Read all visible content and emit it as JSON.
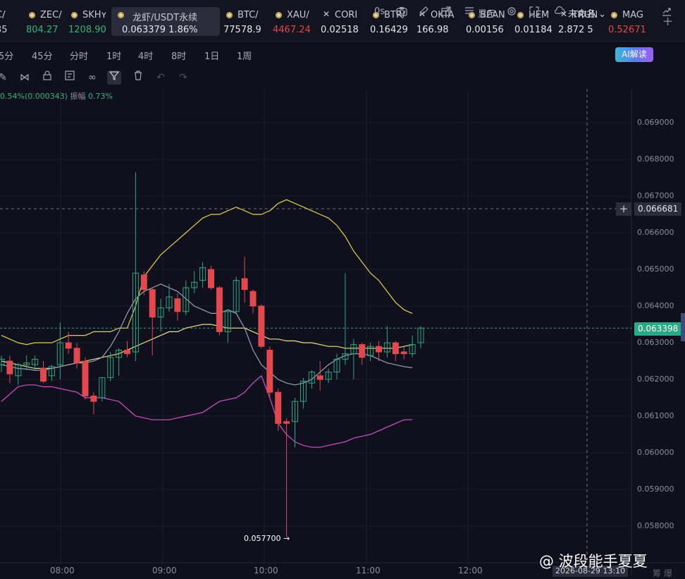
{
  "tickers": [
    {
      "name": "C/",
      "price": "35",
      "price_color": "#c7cad3",
      "marker": "none"
    },
    {
      "name": "ZEC/",
      "price": "804.27",
      "price_color": "#2fb37b",
      "marker": "dot"
    },
    {
      "name": "SKHʏ",
      "price": "1208.90",
      "price_color": "#2fb37b",
      "marker": "dot"
    },
    {
      "name": "龙虾/USDT永续",
      "price": "0.063379",
      "change": "1.86%",
      "price_color": "#e3e5ec",
      "marker": "dot",
      "selected": true
    },
    {
      "name": "BTC/",
      "price": "77578.9",
      "price_color": "#e3e5ec",
      "marker": "dot"
    },
    {
      "name": "XAU/",
      "price": "4467.24",
      "price_color": "#e1494f",
      "marker": "dot"
    },
    {
      "name": "CORI",
      "price": "0.02518",
      "price_color": "#e3e5ec",
      "marker": "x"
    },
    {
      "name": "BTR/",
      "price": "0.16429",
      "price_color": "#e3e5ec",
      "marker": "dot"
    },
    {
      "name": "OKTA",
      "price": "166.98",
      "price_color": "#e3e5ec",
      "marker": "x"
    },
    {
      "name": "BEAN",
      "price": "0.00156",
      "price_color": "#e3e5ec",
      "marker": "dot"
    },
    {
      "name": "HEM",
      "price": "0.01184",
      "price_color": "#e3e5ec",
      "marker": "dot"
    },
    {
      "name": "TRUN",
      "price": "2.872",
      "extra": "5",
      "price_color": "#e3e5ec",
      "marker": "x"
    },
    {
      "name": "MAG",
      "price": "0.52671",
      "price_color": "#e1494f",
      "marker": "dot"
    }
  ],
  "plus_label": "+",
  "timeframes": [
    "5分",
    "45分",
    "分时",
    "1时",
    "4时",
    "8时",
    "1日",
    "1周"
  ],
  "toolbar": {
    "countdown": "0s",
    "display_label": "显示",
    "unnamed_label": "未命名",
    "ai_label": "AI解读"
  },
  "indicator_info": {
    "change": "0.54%(0.000343)",
    "amplitude_label": "振幅",
    "amplitude": "0.73%"
  },
  "price_axis": [
    "0.069000",
    "0.068000",
    "0.067000",
    "0.066000",
    "0.065000",
    "0.064000",
    "0.063000",
    "0.062000",
    "0.061000",
    "0.060000",
    "0.059000",
    "0.058000"
  ],
  "time_axis": [
    "08:00",
    "09:00",
    "10:00",
    "11:00",
    "12:00"
  ],
  "crosshair_price": "0.066681",
  "last_price": "0.063398",
  "low_label": "0.057700 →",
  "crosshair_time": "2026-08-29 13:10",
  "watermark": "@ 波段能手夏夏",
  "watermark_sub": "筹 爆",
  "colors": {
    "up": "#2ca884",
    "down": "#e1494f",
    "bg": "#0f101b"
  },
  "chart_data": {
    "type": "candlestick",
    "title": "龙虾/USDT永续",
    "ylim": [
      0.0575,
      0.0697
    ],
    "candles": [
      {
        "t": "07:30",
        "o": 0.0624,
        "h": 0.06265,
        "l": 0.0622,
        "c": 0.06255
      },
      {
        "t": "07:35",
        "o": 0.0625,
        "h": 0.06265,
        "l": 0.0619,
        "c": 0.06215
      },
      {
        "t": "07:40",
        "o": 0.0621,
        "h": 0.06245,
        "l": 0.06185,
        "c": 0.0624
      },
      {
        "t": "07:45",
        "o": 0.0624,
        "h": 0.06265,
        "l": 0.06225,
        "c": 0.06245
      },
      {
        "t": "07:50",
        "o": 0.0624,
        "h": 0.06265,
        "l": 0.06225,
        "c": 0.06255
      },
      {
        "t": "07:55",
        "o": 0.0623,
        "h": 0.0625,
        "l": 0.0619,
        "c": 0.06195
      },
      {
        "t": "08:00",
        "o": 0.0621,
        "h": 0.0624,
        "l": 0.06195,
        "c": 0.06235
      },
      {
        "t": "08:05",
        "o": 0.0624,
        "h": 0.06355,
        "l": 0.062,
        "c": 0.063
      },
      {
        "t": "08:10",
        "o": 0.063,
        "h": 0.0633,
        "l": 0.0627,
        "c": 0.06285
      },
      {
        "t": "08:15",
        "o": 0.06285,
        "h": 0.063,
        "l": 0.0623,
        "c": 0.06245
      },
      {
        "t": "08:20",
        "o": 0.0625,
        "h": 0.0626,
        "l": 0.06145,
        "c": 0.06155
      },
      {
        "t": "08:25",
        "o": 0.06155,
        "h": 0.06165,
        "l": 0.06105,
        "c": 0.0614
      },
      {
        "t": "08:30",
        "o": 0.0615,
        "h": 0.06205,
        "l": 0.0614,
        "c": 0.06205
      },
      {
        "t": "08:35",
        "o": 0.06205,
        "h": 0.06275,
        "l": 0.06195,
        "c": 0.0626
      },
      {
        "t": "08:40",
        "o": 0.0626,
        "h": 0.06285,
        "l": 0.0621,
        "c": 0.0628
      },
      {
        "t": "08:45",
        "o": 0.0628,
        "h": 0.06305,
        "l": 0.0626,
        "c": 0.0627
      },
      {
        "t": "08:50",
        "o": 0.06275,
        "h": 0.06765,
        "l": 0.0625,
        "c": 0.0649
      },
      {
        "t": "08:55",
        "o": 0.06485,
        "h": 0.06495,
        "l": 0.0643,
        "c": 0.06445
      },
      {
        "t": "09:00",
        "o": 0.06445,
        "h": 0.0645,
        "l": 0.06265,
        "c": 0.0637
      },
      {
        "t": "09:05",
        "o": 0.0637,
        "h": 0.0642,
        "l": 0.0633,
        "c": 0.06395
      },
      {
        "t": "09:10",
        "o": 0.06395,
        "h": 0.0646,
        "l": 0.06385,
        "c": 0.06425
      },
      {
        "t": "09:15",
        "o": 0.0642,
        "h": 0.06435,
        "l": 0.0636,
        "c": 0.06385
      },
      {
        "t": "09:20",
        "o": 0.06385,
        "h": 0.0647,
        "l": 0.06375,
        "c": 0.0645
      },
      {
        "t": "09:25",
        "o": 0.0645,
        "h": 0.06495,
        "l": 0.06435,
        "c": 0.06465
      },
      {
        "t": "09:30",
        "o": 0.0647,
        "h": 0.0652,
        "l": 0.0645,
        "c": 0.06505
      },
      {
        "t": "09:35",
        "o": 0.065,
        "h": 0.0651,
        "l": 0.06445,
        "c": 0.0645
      },
      {
        "t": "09:40",
        "o": 0.0645,
        "h": 0.06455,
        "l": 0.0632,
        "c": 0.0633
      },
      {
        "t": "09:45",
        "o": 0.0633,
        "h": 0.0639,
        "l": 0.063,
        "c": 0.06385
      },
      {
        "t": "09:50",
        "o": 0.06385,
        "h": 0.0648,
        "l": 0.0638,
        "c": 0.0647
      },
      {
        "t": "09:55",
        "o": 0.06475,
        "h": 0.06535,
        "l": 0.0641,
        "c": 0.06445
      },
      {
        "t": "10:00",
        "o": 0.0644,
        "h": 0.06445,
        "l": 0.0638,
        "c": 0.064
      },
      {
        "t": "10:05",
        "o": 0.064,
        "h": 0.06405,
        "l": 0.06285,
        "c": 0.0629
      },
      {
        "t": "10:10",
        "o": 0.0628,
        "h": 0.0629,
        "l": 0.0615,
        "c": 0.06165
      },
      {
        "t": "10:15",
        "o": 0.06165,
        "h": 0.06175,
        "l": 0.0606,
        "c": 0.0608
      },
      {
        "t": "10:20",
        "o": 0.06085,
        "h": 0.06095,
        "l": 0.0577,
        "c": 0.0608
      },
      {
        "t": "10:25",
        "o": 0.06085,
        "h": 0.0615,
        "l": 0.06015,
        "c": 0.0614
      },
      {
        "t": "10:30",
        "o": 0.0614,
        "h": 0.06205,
        "l": 0.0612,
        "c": 0.06195
      },
      {
        "t": "10:35",
        "o": 0.0619,
        "h": 0.06225,
        "l": 0.06175,
        "c": 0.0622
      },
      {
        "t": "10:40",
        "o": 0.0621,
        "h": 0.0625,
        "l": 0.0617,
        "c": 0.062
      },
      {
        "t": "10:45",
        "o": 0.062,
        "h": 0.0623,
        "l": 0.0619,
        "c": 0.0622
      },
      {
        "t": "10:50",
        "o": 0.0622,
        "h": 0.0627,
        "l": 0.062,
        "c": 0.06255
      },
      {
        "t": "10:55",
        "o": 0.06255,
        "h": 0.0649,
        "l": 0.0624,
        "c": 0.0627
      },
      {
        "t": "11:00",
        "o": 0.0627,
        "h": 0.0631,
        "l": 0.062,
        "c": 0.06295
      },
      {
        "t": "11:05",
        "o": 0.06295,
        "h": 0.063,
        "l": 0.0624,
        "c": 0.0626
      },
      {
        "t": "11:10",
        "o": 0.06265,
        "h": 0.063,
        "l": 0.0625,
        "c": 0.0629
      },
      {
        "t": "11:15",
        "o": 0.0629,
        "h": 0.06305,
        "l": 0.0625,
        "c": 0.06275
      },
      {
        "t": "11:20",
        "o": 0.06275,
        "h": 0.06345,
        "l": 0.0626,
        "c": 0.063
      },
      {
        "t": "11:25",
        "o": 0.063,
        "h": 0.06305,
        "l": 0.0625,
        "c": 0.0627
      },
      {
        "t": "11:30",
        "o": 0.06275,
        "h": 0.0629,
        "l": 0.06255,
        "c": 0.0627
      },
      {
        "t": "11:35",
        "o": 0.0627,
        "h": 0.0632,
        "l": 0.0626,
        "c": 0.06295
      },
      {
        "t": "11:40",
        "o": 0.063,
        "h": 0.06345,
        "l": 0.06285,
        "c": 0.0634
      }
    ],
    "series": [
      {
        "type": "line",
        "color": "#e2d14c",
        "values": [
          0.0632,
          0.0631,
          0.063,
          0.06295,
          0.063,
          0.063,
          0.063,
          0.0631,
          0.0632,
          0.0632,
          0.0632,
          0.0633,
          0.0633,
          0.0633,
          0.0634,
          0.0634,
          0.064,
          0.0648,
          0.0651,
          0.0654,
          0.0656,
          0.0658,
          0.066,
          0.0662,
          0.0664,
          0.0665,
          0.0665,
          0.0666,
          0.0667,
          0.0666,
          0.0665,
          0.0665,
          0.0666,
          0.0668,
          0.0669,
          0.0668,
          0.0667,
          0.0666,
          0.0665,
          0.0664,
          0.0662,
          0.0659,
          0.0655,
          0.0652,
          0.0649,
          0.0647,
          0.0644,
          0.0641,
          0.0639,
          0.0638
        ]
      },
      {
        "type": "line",
        "color": "#d34fd1",
        "values": [
          0.0614,
          0.0616,
          0.0618,
          0.06185,
          0.06185,
          0.0618,
          0.0618,
          0.06175,
          0.0617,
          0.06165,
          0.0615,
          0.0615,
          0.0615,
          0.06145,
          0.0614,
          0.0612,
          0.061,
          0.06095,
          0.0609,
          0.0609,
          0.0609,
          0.06095,
          0.061,
          0.06105,
          0.0611,
          0.06125,
          0.0614,
          0.06145,
          0.0615,
          0.06165,
          0.0619,
          0.0621,
          0.0615,
          0.0608,
          0.0605,
          0.0603,
          0.0602,
          0.06015,
          0.06015,
          0.0602,
          0.06025,
          0.0603,
          0.0604,
          0.06045,
          0.0605,
          0.0606,
          0.0607,
          0.0608,
          0.0609,
          0.0609
        ]
      },
      {
        "type": "line",
        "color": "#e8e08a",
        "values": [
          0.0625,
          0.06245,
          0.0624,
          0.06235,
          0.0623,
          0.0623,
          0.0623,
          0.06235,
          0.0624,
          0.06245,
          0.0625,
          0.06255,
          0.0626,
          0.06265,
          0.0627,
          0.0628,
          0.0629,
          0.063,
          0.0631,
          0.0632,
          0.0633,
          0.0633,
          0.0634,
          0.06345,
          0.0635,
          0.0635,
          0.06345,
          0.0634,
          0.0634,
          0.0634,
          0.0633,
          0.0632,
          0.0631,
          0.0631,
          0.06305,
          0.06305,
          0.063,
          0.063,
          0.06295,
          0.0629,
          0.0629,
          0.06285,
          0.06285,
          0.06285,
          0.06285,
          0.06285,
          0.06285,
          0.06285,
          0.0629,
          0.06295
        ]
      },
      {
        "type": "line",
        "color": "#9aa0c0",
        "values": [
          0.0624,
          0.06235,
          0.0623,
          0.06228,
          0.06225,
          0.06225,
          0.0623,
          0.06235,
          0.0624,
          0.06245,
          0.06245,
          0.0625,
          0.0626,
          0.0629,
          0.0633,
          0.0638,
          0.0642,
          0.0644,
          0.0645,
          0.0646,
          0.0645,
          0.0644,
          0.0642,
          0.064,
          0.0639,
          0.0638,
          0.0638,
          0.0639,
          0.0638,
          0.0634,
          0.0628,
          0.0624,
          0.0622,
          0.062,
          0.0619,
          0.06185,
          0.0619,
          0.062,
          0.0622,
          0.0624,
          0.06255,
          0.06265,
          0.0627,
          0.0627,
          0.06265,
          0.06255,
          0.06245,
          0.0624,
          0.06235,
          0.06232
        ]
      }
    ]
  }
}
